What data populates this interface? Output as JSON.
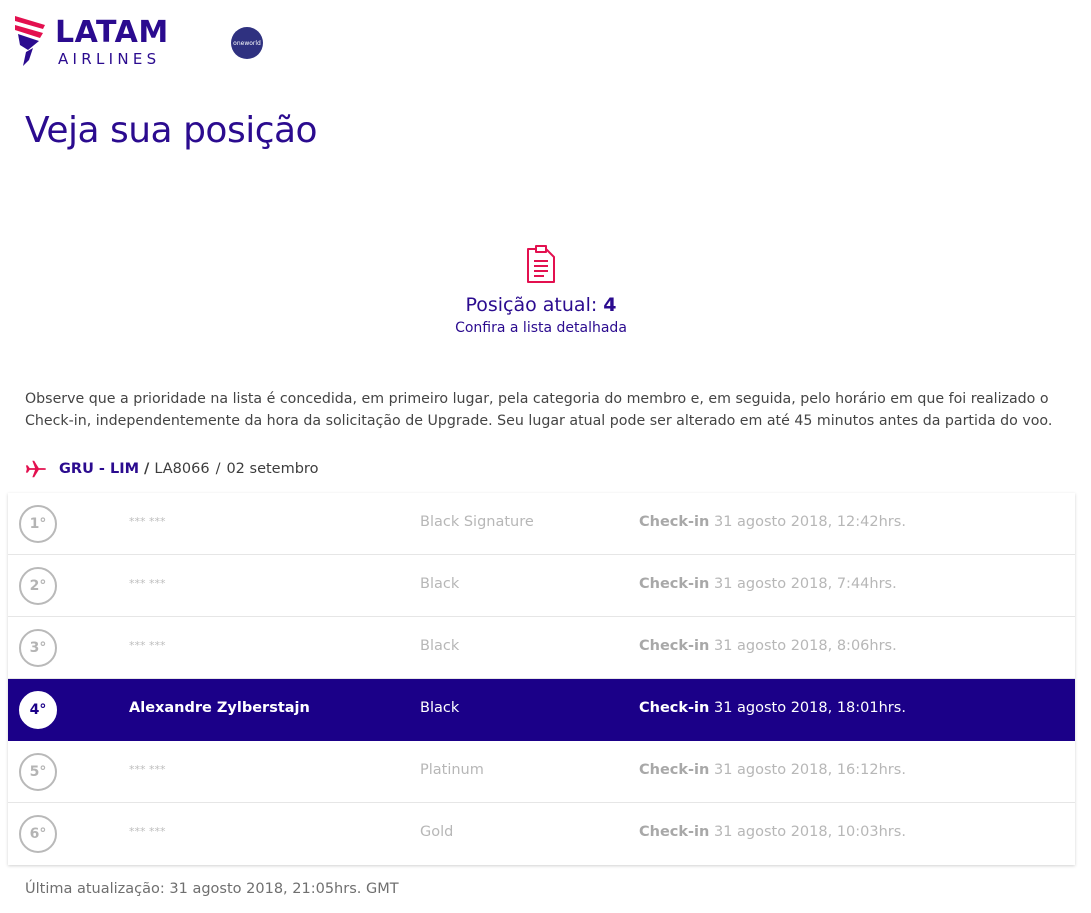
{
  "header": {
    "brand_top": "LATAM",
    "brand_bottom": "AIRLINES",
    "alliance_badge": "oneworld",
    "brand_color": "#2b0b8f",
    "accent_color": "#e3104f"
  },
  "page_title": "Veja sua posição",
  "summary": {
    "icon": "document-list-icon",
    "position_label": "Posição atual:",
    "position_value": "4",
    "detail_link": "Confira a lista detalhada"
  },
  "note": "Observe que a prioridade na lista é concedida, em primeiro lugar, pela categoria do membro e, em seguida, pelo horário em que foi realizado o Check-in, independentemente da hora da solicitação de Upgrade. Seu lugar atual pode ser alterado em até 45 minutos antes da partida do voo.",
  "flight": {
    "icon": "airplane-icon",
    "route": "GRU - LIM",
    "separator": "/",
    "number": "LA8066",
    "date": "02 setembro"
  },
  "list": {
    "checkin_label": "Check-in",
    "highlight_color": "#1b0088",
    "rows": [
      {
        "rank": "1°",
        "name": "*** ***",
        "tier": "Black Signature",
        "checkin": "31 agosto 2018, 12:42hrs.",
        "active": false
      },
      {
        "rank": "2°",
        "name": "*** ***",
        "tier": "Black",
        "checkin": "31 agosto 2018, 7:44hrs.",
        "active": false
      },
      {
        "rank": "3°",
        "name": "*** ***",
        "tier": "Black",
        "checkin": "31 agosto 2018, 8:06hrs.",
        "active": false
      },
      {
        "rank": "4°",
        "name": "Alexandre Zylberstajn",
        "tier": "Black",
        "checkin": "31 agosto 2018, 18:01hrs.",
        "active": true
      },
      {
        "rank": "5°",
        "name": "*** ***",
        "tier": "Platinum",
        "checkin": "31 agosto 2018, 16:12hrs.",
        "active": false
      },
      {
        "rank": "6°",
        "name": "*** ***",
        "tier": "Gold",
        "checkin": "31 agosto 2018, 10:03hrs.",
        "active": false
      }
    ]
  },
  "footer": {
    "last_update": "Última atualização: 31 agosto 2018, 21:05hrs. GMT"
  }
}
